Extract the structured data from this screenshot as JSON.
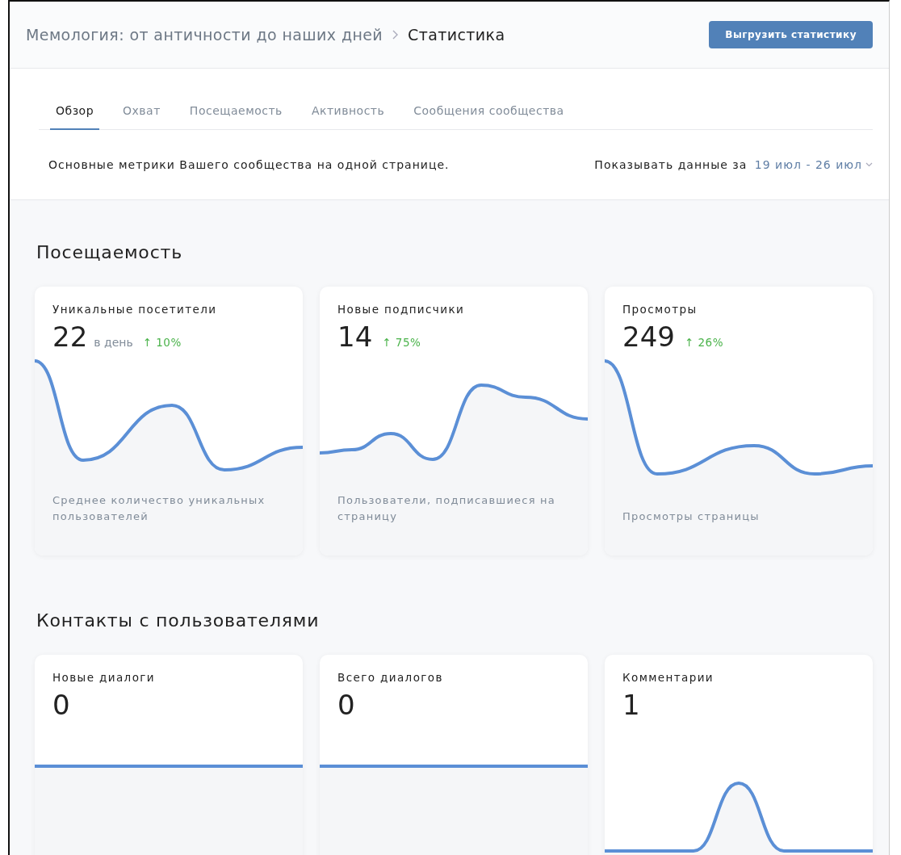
{
  "header": {
    "breadcrumb": [
      "Мемология: от античности до наших дней",
      "Статистика"
    ],
    "export_button": "Выгрузить статистику"
  },
  "tabs": [
    {
      "label": "Обзор",
      "selected": true
    },
    {
      "label": "Охват",
      "selected": false
    },
    {
      "label": "Посещаемость",
      "selected": false
    },
    {
      "label": "Активность",
      "selected": false
    },
    {
      "label": "Сообщения сообщества",
      "selected": false
    }
  ],
  "description": "Основные метрики Вашего сообщества на одной странице.",
  "period": {
    "label": "Показывать данные за",
    "value": "19 июл - 26 июл"
  },
  "sections": [
    {
      "title": "Посещаемость",
      "cards": [
        {
          "title": "Уникальные посетители",
          "value": "22",
          "unit": "в день",
          "delta": "↑ 10%",
          "caption": "Среднее количество уникальных пользователей"
        },
        {
          "title": "Новые подписчики",
          "value": "14",
          "delta": "↑ 75%",
          "caption": "Пользователи, подписавшиеся на страницу"
        },
        {
          "title": "Просмотры",
          "value": "249",
          "delta": "↑ 26%",
          "caption": "Просмотры страницы"
        }
      ]
    },
    {
      "title": "Контакты с пользователями",
      "cards": [
        {
          "title": "Новые диалоги",
          "value": "0"
        },
        {
          "title": "Всего диалогов",
          "value": "0"
        },
        {
          "title": "Комментарии",
          "value": "1"
        }
      ]
    }
  ]
}
